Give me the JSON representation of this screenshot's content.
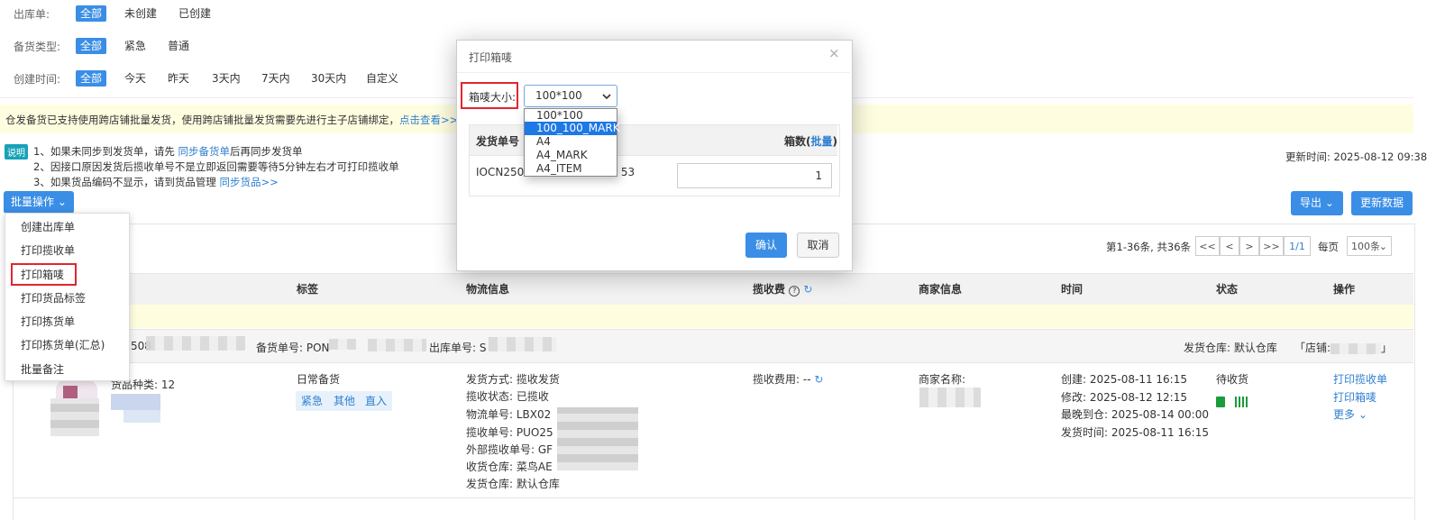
{
  "filters": {
    "outbound": {
      "label": "出库单:",
      "options": [
        "全部",
        "未创建",
        "已创建"
      ]
    },
    "stock_type": {
      "label": "备货类型:",
      "options": [
        "全部",
        "紧急",
        "普通"
      ]
    },
    "created_time": {
      "label": "创建时间:",
      "options": [
        "全部",
        "今天",
        "昨天",
        "3天内",
        "7天内",
        "30天内",
        "自定义"
      ]
    }
  },
  "notice": {
    "text": "仓发备货已支持使用跨店铺批量发货，使用跨店铺批量发货需要先进行主子店铺绑定，",
    "link": "点击查看>>"
  },
  "instructions": {
    "badge": "说明",
    "line1_prefix": "1、如果未同步到发货单，请先 ",
    "line1_link": "同步备货单",
    "line1_suffix": "后再同步发货单",
    "line2": "2、因接口原因发货后揽收单号不是立即返回需要等待5分钟左右才可打印揽收单",
    "line3_prefix": "3、如果货品编码不显示，请到货品管理 ",
    "line3_link": "同步货品>>"
  },
  "update_time": "更新时间: 2025-08-12 09:38",
  "toolbar": {
    "batch_label": "批量操作",
    "export_label": "导出",
    "refresh_label": "更新数据"
  },
  "batch_menu": [
    "创建出库单",
    "打印揽收单",
    "打印箱唛",
    "打印货品标签",
    "打印拣货单",
    "打印拣货单(汇总)",
    "批量备注"
  ],
  "pagination": {
    "summary": "第1-36条, 共36条",
    "first": "<<",
    "prev": "<",
    "next": ">",
    "last": ">>",
    "page": "1/1",
    "per_page_label": "每页",
    "per_page_value": "100条"
  },
  "table": {
    "headers": [
      "标签",
      "物流信息",
      "揽收费",
      "商家信息",
      "时间",
      "状态",
      "操作"
    ],
    "group_row": {
      "order_prefix": "508",
      "stock_no_label": "备货单号: PON",
      "outbound_no_label": "出库单号: S",
      "warehouse": "发货仓库: 默认仓库",
      "store_prefix": "「店铺:",
      "store_suffix": "」"
    },
    "row": {
      "goods_types": "货品种类: 12",
      "tag_title": "日常备货",
      "tags": [
        "紧急",
        "其他",
        "直入"
      ],
      "logistics": [
        "发货方式: 揽收发货",
        "揽收状态: 已揽收",
        "物流单号: LBX02",
        "揽收单号: PUO25",
        "外部揽收单号: GF",
        "收货仓库: 菜鸟AE",
        "发货仓库: 默认仓库"
      ],
      "fee_label": "揽收费用: --",
      "merchant_label": "商家名称:",
      "times": [
        "创建: 2025-08-11 16:15",
        "修改: 2025-08-12 12:15",
        "最晚到仓: 2025-08-14 00:00",
        "发货时间: 2025-08-11 16:15"
      ],
      "status": "待收货",
      "actions": [
        "打印揽收单",
        "打印箱唛",
        "更多"
      ]
    }
  },
  "modal": {
    "title": "打印箱唛",
    "close": "×",
    "size_label": "箱唛大小:",
    "size_value": "100*100",
    "size_options": [
      "100*100",
      "100_100_MARK",
      "A4",
      "A4_MARK",
      "A4_ITEM"
    ],
    "selected_option": "100_100_MARK",
    "col_order": "发货单号",
    "col_boxes": "箱数(",
    "col_boxes_link": "批量",
    "col_boxes_end": ")",
    "row_order_prefix": "IOCN2508",
    "row_order_suffix": "53",
    "row_boxes": "1",
    "confirm": "确认",
    "cancel": "取消"
  },
  "colors": {
    "primary": "#3a8ee6",
    "notice_bg": "#fffde0",
    "highlight": "#e0262e"
  }
}
